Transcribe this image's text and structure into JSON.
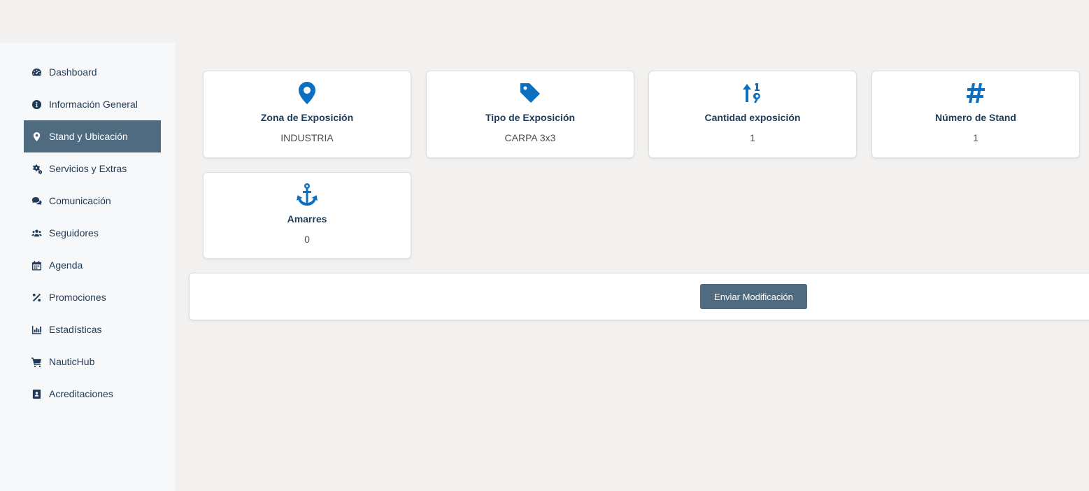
{
  "sidebar": {
    "items": [
      {
        "label": "Dashboard",
        "icon": "dashboard-icon"
      },
      {
        "label": "Información General",
        "icon": "info-circle-icon"
      },
      {
        "label": "Stand y Ubicación",
        "icon": "map-pin-icon",
        "active": true
      },
      {
        "label": "Servicios y Extras",
        "icon": "cogs-icon"
      },
      {
        "label": "Comunicación",
        "icon": "comments-icon"
      },
      {
        "label": "Seguidores",
        "icon": "users-icon"
      },
      {
        "label": "Agenda",
        "icon": "calendar-icon"
      },
      {
        "label": "Promociones",
        "icon": "percent-icon"
      },
      {
        "label": "Estadísticas",
        "icon": "chart-icon"
      },
      {
        "label": "NauticHub",
        "icon": "cart-icon"
      },
      {
        "label": "Acreditaciones",
        "icon": "id-badge-icon"
      }
    ]
  },
  "cards": [
    {
      "title": "Zona de Exposición",
      "value": "INDUSTRIA",
      "icon": "map-pin-icon"
    },
    {
      "title": "Tipo de Exposición",
      "value": "CARPA 3x3",
      "icon": "tag-icon"
    },
    {
      "title": "Cantidad exposición",
      "value": "1",
      "icon": "sort-numeric-icon"
    },
    {
      "title": "Número de Stand",
      "value": "1",
      "icon": "hashtag-icon"
    },
    {
      "title": "Amarres",
      "value": "0",
      "icon": "anchor-icon"
    }
  ],
  "actions": {
    "submit_label": "Enviar Modificación"
  },
  "colors": {
    "accent": "#0b6fc2",
    "active_nav": "#4f6b80",
    "text": "#1f3b57"
  }
}
